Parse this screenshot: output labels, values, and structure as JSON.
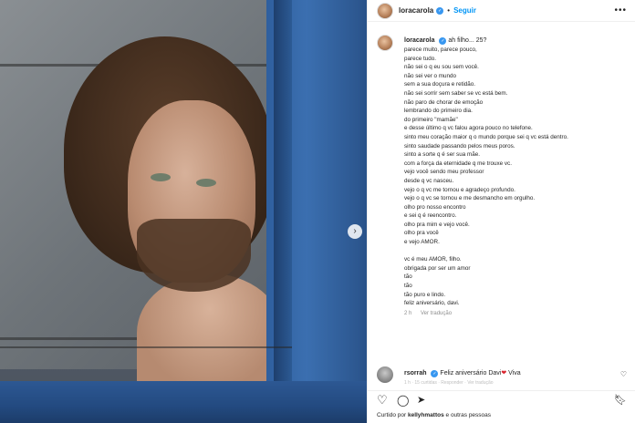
{
  "post": {
    "username": "loracarola",
    "follow_label": "Seguir",
    "dot": "•",
    "more_label": "•••",
    "carousel_next": "›"
  },
  "caption": {
    "username": "loracarola",
    "title": "ah filho... 25?",
    "lines": [
      "parece muito, parece pouco,",
      "parece tudo.",
      "não sei o q eu sou sem você.",
      "não sei ver o mundo",
      "sem a sua doçura e retidão.",
      "não sei sorrir sem saber se vc está bem.",
      "não paro de chorar de emoção",
      "lembrando do primeiro dia.",
      "do primeiro \"mamãe\"",
      "e desse último q vc falou agora pouco no telefone.",
      "sinto meu coração maior q o mundo porque sei q vc está dentro.",
      "sinto saudade passando pelos meus poros.",
      "sinto a sorte q é ser sua mãe.",
      "com a força da eternidade q me trouxe vc.",
      "vejo você sendo meu professor",
      "desde q vc nasceu.",
      "vejo o q vc me tornou e agradeço profundo.",
      "vejo o q vc se tornou e me desmancho em orgulho.",
      "olho pro nosso encontro",
      "e sei q é reencontro.",
      "olho pra mim e vejo você.",
      "olho pra você",
      "e vejo AMOR."
    ],
    "lines2": [
      "vc é meu AMOR, filho.",
      "obrigada por ser um amor",
      "tão",
      "tão",
      "tão puro e lindo.",
      "feliz aniversário, davi."
    ],
    "time": "2 h",
    "translate_label": "Ver tradução"
  },
  "comment": {
    "username": "rsorrah",
    "text": "Feliz aniversário Davi",
    "suffix": "Viva",
    "meta": "1 h · 15 curtidas · Responder · Ver tradução"
  },
  "likes": {
    "prefix": "Curtido por ",
    "user": "kellyhmattos",
    "suffix": " e outras pessoas"
  },
  "icons": {
    "like": "heart-icon",
    "comment": "comment-icon",
    "share": "share-icon",
    "save": "bookmark-icon"
  },
  "colors": {
    "accent": "#0095f6",
    "verified": "#3897f0",
    "heart": "#d9242e"
  }
}
